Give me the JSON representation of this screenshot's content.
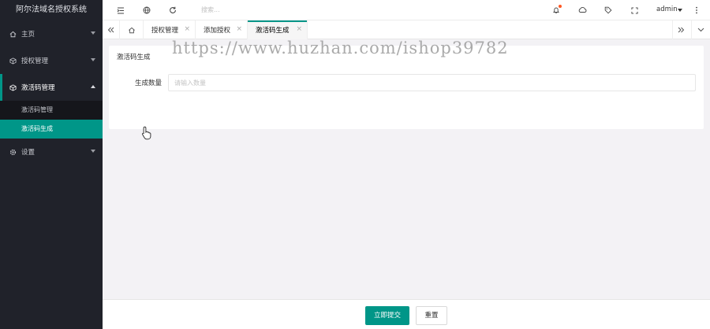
{
  "sidebar": {
    "title": "阿尔法域名授权系统",
    "items": [
      {
        "label": "主页",
        "icon": "home-icon"
      },
      {
        "label": "授权管理",
        "icon": "cube-icon"
      },
      {
        "label": "激活码管理",
        "icon": "cube-icon",
        "open": true,
        "children": [
          {
            "label": "激活码管理"
          },
          {
            "label": "激活码生成",
            "active": true
          }
        ]
      },
      {
        "label": "设置",
        "icon": "gear-icon"
      }
    ]
  },
  "header": {
    "search_placeholder": "搜索...",
    "user": "admin"
  },
  "tabs": [
    {
      "label": "授权管理"
    },
    {
      "label": "添加授权"
    },
    {
      "label": "激活码生成",
      "active": true
    }
  ],
  "panel": {
    "title": "激活码生成",
    "field_label": "生成数量",
    "field_placeholder": "请输入数量",
    "field_value": ""
  },
  "watermark": "https://www.huzhan.com/ishop39782",
  "footer": {
    "submit": "立即提交",
    "reset": "重置"
  },
  "colors": {
    "accent": "#009688",
    "sidebar_bg": "#20222a",
    "badge": "#ff5722"
  }
}
